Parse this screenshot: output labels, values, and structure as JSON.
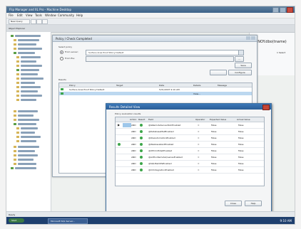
{
  "app": {
    "title": "Flip Manager and XL Pro - Machine Desktop"
  },
  "menu": [
    "File",
    "Edit",
    "View",
    "Tools",
    "Window",
    "Community",
    "Help"
  ],
  "toolbar": {
    "new_query": "New Query"
  },
  "tree_header": "Object Explorer",
  "right_pane": {
    "title": "MONOY.dbo(tname)",
    "sub": "1 Select"
  },
  "main_dialog": {
    "title": "Policy / Check Completed",
    "section_label": "Select policy",
    "radio_server": "From server:",
    "server_value": "Surface Area Proof Policy Default",
    "radio_file": "From file:",
    "btn_browse": "...",
    "btn_save": "Save",
    "btn_configure": "Configure",
    "results_label": "Results",
    "grid_headers": [
      "Policy",
      "Target",
      "Date",
      "Details",
      "Message"
    ],
    "rows": [
      {
        "policy": "Surface Area Proof Policy Default",
        "target": "",
        "date": "5/31/2007 9:10 AM",
        "details": "",
        "message": ""
      },
      {
        "policy": "",
        "target": "",
        "date": "",
        "details": "",
        "message": ""
      }
    ],
    "selected_details": "View..."
  },
  "inner_dialog": {
    "title": "Results Detailed View",
    "caption": "Policy evaluation results",
    "grid_headers": [
      "",
      "Action",
      "Result",
      "Field",
      "Operator",
      "Expected Value",
      "Actual Value"
    ],
    "rows": [
      {
        "action": "AND",
        "field": "@IsRemoteServerDACEnabled",
        "op": "=",
        "expected": "False",
        "actual": "False"
      },
      {
        "action": "AND",
        "field": "@DatabaseMailEnabled",
        "op": "=",
        "expected": "False",
        "actual": "False"
      },
      {
        "action": "AND",
        "field": "@OleAutomationEnabled",
        "op": "=",
        "expected": "False",
        "actual": "False"
      },
      {
        "action": "AND",
        "field": "@WebAssistantEnabled",
        "op": "=",
        "expected": "False",
        "actual": "False"
      },
      {
        "action": "AND",
        "field": "@XPCmdShellEnabled",
        "op": "=",
        "expected": "False",
        "actual": "False"
      },
      {
        "action": "AND",
        "field": "@AdHocRemoteQueriesEnabled",
        "op": "=",
        "expected": "False",
        "actual": "False"
      },
      {
        "action": "AND",
        "field": "@SQLMailXPsEnabled",
        "op": "=",
        "expected": "False",
        "actual": "False"
      },
      {
        "action": "AND",
        "field": "@ClrIntegrationEnabled",
        "op": "=",
        "expected": "False",
        "actual": "False"
      }
    ],
    "btn_close": "Close",
    "btn_help": "Help"
  },
  "status": {
    "ready": "Ready"
  },
  "taskbar": {
    "start": "Start",
    "item": "Microsoft SQL Server...",
    "clock": "9:10 AM"
  },
  "colors": {
    "title_blue": "#2a5d96",
    "ok_green": "#3da64a",
    "taskbar": "#1e3f6e"
  },
  "icons": [
    "search-icon",
    "folder-icon",
    "database-icon",
    "check-circle-icon",
    "close-icon"
  ]
}
